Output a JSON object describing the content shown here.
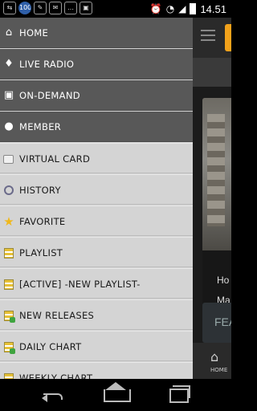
{
  "status_bar": {
    "time": "14.51",
    "left_icons": [
      "usb-icon",
      "notification-100-icon",
      "wrench-icon",
      "mail-icon",
      "message-icon",
      "gallery-icon"
    ],
    "badge_text": "100",
    "right_icons": [
      "alarm-icon",
      "wifi-icon",
      "signal-icon",
      "battery-icon"
    ]
  },
  "drawer": {
    "items": [
      {
        "label": "HOME",
        "icon": "home-icon"
      },
      {
        "label": "LIVE RADIO",
        "icon": "microphone-icon"
      },
      {
        "label": "ON-DEMAND",
        "icon": "radio-icon"
      },
      {
        "label": "MEMBER",
        "icon": "members-icon"
      },
      {
        "label": "VIRTUAL CARD",
        "icon": "card-icon"
      },
      {
        "label": "HISTORY",
        "icon": "clock-icon"
      },
      {
        "label": "FAVORITE",
        "icon": "star-icon"
      },
      {
        "label": "PLAYLIST",
        "icon": "playlist-icon"
      },
      {
        "label": "[ACTIVE] -NEW PLAYLIST-",
        "icon": "playlist-icon"
      },
      {
        "label": "NEW RELEASES",
        "icon": "playlist-new-icon"
      },
      {
        "label": "DAILY CHART",
        "icon": "playlist-new-icon"
      },
      {
        "label": "WEEKLY CHART",
        "icon": "playlist-new-icon"
      }
    ]
  },
  "main": {
    "card_text_1": "Ho",
    "card_text_2": "Ma",
    "feature_label": "FEA",
    "home_tab_label": "HOME"
  },
  "colors": {
    "drawer_dark": "#585858",
    "drawer_light": "#d4d4d4",
    "accent_orange": "#f2a21b"
  }
}
